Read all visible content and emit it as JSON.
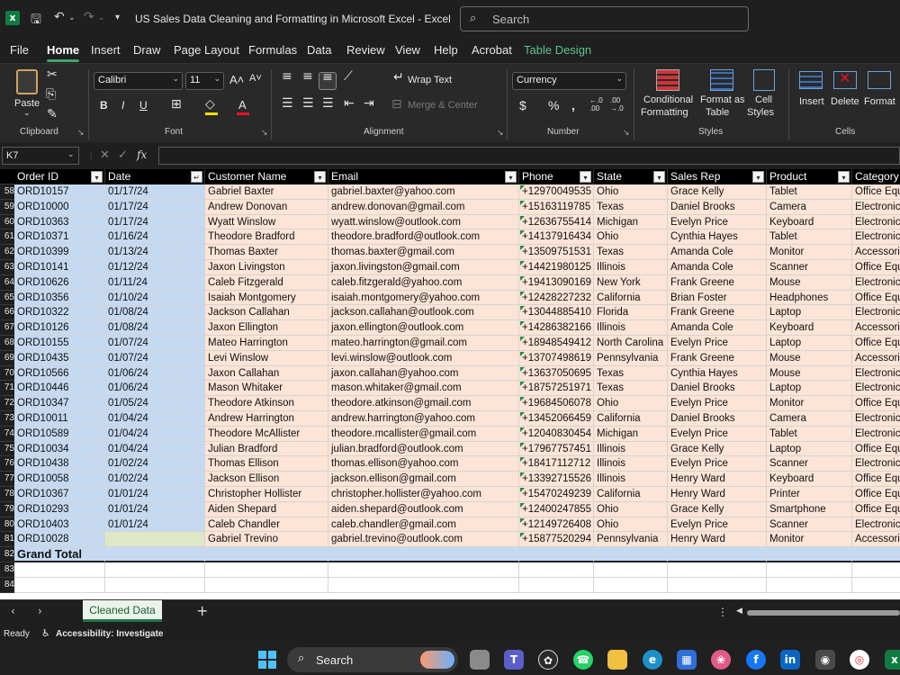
{
  "window": {
    "title": "US Sales Data Cleaning and Formatting in Microsoft Excel  -  Excel",
    "search_placeholder": "Search"
  },
  "menu": [
    "File",
    "Home",
    "Insert",
    "Draw",
    "Page Layout",
    "Formulas",
    "Data",
    "Review",
    "View",
    "Help",
    "Acrobat",
    "Table Design"
  ],
  "ribbon": {
    "clipboard": {
      "paste": "Paste",
      "label": "Clipboard"
    },
    "font": {
      "name": "Calibri",
      "size": "11",
      "label": "Font"
    },
    "alignment": {
      "wrap": "Wrap Text",
      "merge": "Merge & Center",
      "label": "Alignment"
    },
    "number": {
      "format": "Currency",
      "label": "Number"
    },
    "styles": {
      "conditional": "Conditional",
      "formatting": "Formatting",
      "format_as": "Format as",
      "table": "Table",
      "cell": "Cell",
      "styles": "Styles",
      "label": "Styles"
    },
    "cells": {
      "insert": "Insert",
      "delete": "Delete",
      "format": "Format",
      "label": "Cells"
    }
  },
  "formula_bar": {
    "name_box": "K7",
    "fx": "fx"
  },
  "columns": [
    "Order ID",
    "Date",
    "Customer Name",
    "Email",
    "Phone",
    "State",
    "Sales Rep",
    "Product",
    "Category"
  ],
  "row_numbers": [
    "58",
    "59",
    "60",
    "61",
    "62",
    "63",
    "64",
    "65",
    "66",
    "67",
    "68",
    "69",
    "70",
    "71",
    "72",
    "73",
    "74",
    "75",
    "76",
    "77",
    "78",
    "79",
    "80",
    "81",
    "82",
    "83",
    "84"
  ],
  "rows": [
    [
      "ORD10157",
      "01/17/24",
      "Gabriel Baxter",
      "gabriel.baxter@yahoo.com",
      "+12970049535",
      "Ohio",
      "Grace Kelly",
      "Tablet",
      "Office Equ"
    ],
    [
      "ORD10000",
      "01/17/24",
      "Andrew Donovan",
      "andrew.donovan@gmail.com",
      "+15163119785",
      "Texas",
      "Daniel Brooks",
      "Camera",
      "Electronic"
    ],
    [
      "ORD10363",
      "01/17/24",
      "Wyatt Winslow",
      "wyatt.winslow@outlook.com",
      "+12636755414",
      "Michigan",
      "Evelyn Price",
      "Keyboard",
      "Electronic"
    ],
    [
      "ORD10371",
      "01/16/24",
      "Theodore Bradford",
      "theodore.bradford@outlook.com",
      "+14137916434",
      "Ohio",
      "Cynthia Hayes",
      "Tablet",
      "Electronic"
    ],
    [
      "ORD10399",
      "01/13/24",
      "Thomas Baxter",
      "thomas.baxter@gmail.com",
      "+13509751531",
      "Texas",
      "Amanda Cole",
      "Monitor",
      "Accessori"
    ],
    [
      "ORD10141",
      "01/12/24",
      "Jaxon Livingston",
      "jaxon.livingston@gmail.com",
      "+14421980125",
      "Illinois",
      "Amanda Cole",
      "Scanner",
      "Office Equ"
    ],
    [
      "ORD10626",
      "01/11/24",
      "Caleb Fitzgerald",
      "caleb.fitzgerald@yahoo.com",
      "+19413090169",
      "New York",
      "Frank Greene",
      "Mouse",
      "Electronic"
    ],
    [
      "ORD10356",
      "01/10/24",
      "Isaiah Montgomery",
      "isaiah.montgomery@yahoo.com",
      "+12428227232",
      "California",
      "Brian Foster",
      "Headphones",
      "Office Equ"
    ],
    [
      "ORD10322",
      "01/08/24",
      "Jackson Callahan",
      "jackson.callahan@outlook.com",
      "+13044885410",
      "Florida",
      "Frank Greene",
      "Laptop",
      "Electronic"
    ],
    [
      "ORD10126",
      "01/08/24",
      "Jaxon Ellington",
      "jaxon.ellington@outlook.com",
      "+14286382166",
      "Illinois",
      "Amanda Cole",
      "Keyboard",
      "Accessori"
    ],
    [
      "ORD10155",
      "01/07/24",
      "Mateo Harrington",
      "mateo.harrington@gmail.com",
      "+18948549412",
      "North Carolina",
      "Evelyn Price",
      "Laptop",
      "Office Equ"
    ],
    [
      "ORD10435",
      "01/07/24",
      "Levi Winslow",
      "levi.winslow@outlook.com",
      "+13707498619",
      "Pennsylvania",
      "Frank Greene",
      "Mouse",
      "Accessori"
    ],
    [
      "ORD10566",
      "01/06/24",
      "Jaxon Callahan",
      "jaxon.callahan@yahoo.com",
      "+13637050695",
      "Texas",
      "Cynthia Hayes",
      "Mouse",
      "Electronic"
    ],
    [
      "ORD10446",
      "01/06/24",
      "Mason Whitaker",
      "mason.whitaker@gmail.com",
      "+18757251971",
      "Texas",
      "Daniel Brooks",
      "Laptop",
      "Electronic"
    ],
    [
      "ORD10347",
      "01/05/24",
      "Theodore Atkinson",
      "theodore.atkinson@gmail.com",
      "+19684506078",
      "Ohio",
      "Evelyn Price",
      "Monitor",
      "Office Equ"
    ],
    [
      "ORD10011",
      "01/04/24",
      "Andrew Harrington",
      "andrew.harrington@yahoo.com",
      "+13452066459",
      "California",
      "Daniel Brooks",
      "Camera",
      "Electronic"
    ],
    [
      "ORD10589",
      "01/04/24",
      "Theodore McAllister",
      "theodore.mcallister@gmail.com",
      "+12040830454",
      "Michigan",
      "Evelyn Price",
      "Tablet",
      "Electronic"
    ],
    [
      "ORD10034",
      "01/04/24",
      "Julian Bradford",
      "julian.bradford@outlook.com",
      "+17967757451",
      "Illinois",
      "Grace Kelly",
      "Laptop",
      "Office Equ"
    ],
    [
      "ORD10438",
      "01/02/24",
      "Thomas Ellison",
      "thomas.ellison@yahoo.com",
      "+18417112712",
      "Illinois",
      "Evelyn Price",
      "Scanner",
      "Electronic"
    ],
    [
      "ORD10058",
      "01/02/24",
      "Jackson Ellison",
      "jackson.ellison@gmail.com",
      "+13392715526",
      "Illinois",
      "Henry Ward",
      "Keyboard",
      "Office Equ"
    ],
    [
      "ORD10367",
      "01/01/24",
      "Christopher Hollister",
      "christopher.hollister@yahoo.com",
      "+15470249239",
      "California",
      "Henry Ward",
      "Printer",
      "Office Equ"
    ],
    [
      "ORD10293",
      "01/01/24",
      "Aiden Shepard",
      "aiden.shepard@outlook.com",
      "+12400247855",
      "Ohio",
      "Grace Kelly",
      "Smartphone",
      "Office Equ"
    ],
    [
      "ORD10403",
      "01/01/24",
      "Caleb Chandler",
      "caleb.chandler@gmail.com",
      "+12149726408",
      "Ohio",
      "Evelyn Price",
      "Scanner",
      "Electronic"
    ],
    [
      "ORD10028",
      "",
      "Gabriel Trevino",
      "gabriel.trevino@outlook.com",
      "+15877520294",
      "Pennsylvania",
      "Henry Ward",
      "Monitor",
      "Accessori"
    ]
  ],
  "grand_total": "Grand Total",
  "sheet_tab": "Cleaned Data",
  "status": {
    "ready": "Ready",
    "accessibility": "Accessibility: Investigate"
  },
  "taskbar": {
    "search": "Search"
  }
}
